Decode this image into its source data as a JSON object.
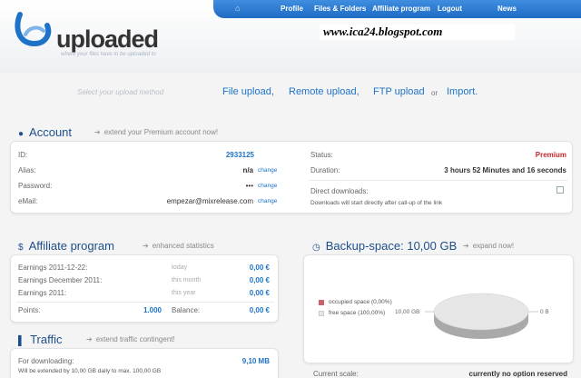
{
  "topnav": {
    "items": [
      "Profile",
      "Files & Folders",
      "Affiliate program",
      "Logout",
      "News"
    ]
  },
  "logo": {
    "text": "uploaded",
    "tagline": "where your files have to be uploaded to"
  },
  "blog_label": "www.ica24.blogspot.com",
  "upload_methods": {
    "hint": "Select your upload method",
    "options": [
      "File upload,",
      "Remote upload,",
      "FTP upload",
      "Import."
    ],
    "or": "or"
  },
  "account": {
    "title": "Account",
    "subtitle": "extend your Premium account now!",
    "id_label": "ID:",
    "id_value": "2933125",
    "alias_label": "Alias:",
    "alias_value": "n/a",
    "password_label": "Password:",
    "password_value": "•••",
    "email_label": "eMail:",
    "email_value": "empezar@mixrelease.com",
    "change": "change",
    "status_label": "Status:",
    "status_value": "Premium",
    "duration_label": "Duration:",
    "duration_value": "3 hours 52 Minutes and 16 seconds",
    "direct_label": "Direct downloads:",
    "direct_note": "Downloads will start directly after call-up of the link"
  },
  "affiliate": {
    "title": "Affiliate program",
    "subtitle": "enhanced statistics",
    "rows": [
      {
        "label": "Earnings 2011-12-22:",
        "period": "today",
        "value": "0,00 €"
      },
      {
        "label": "Earnings December 2011:",
        "period": "this month",
        "value": "0,00 €"
      },
      {
        "label": "Earnings 2011:",
        "period": "this year",
        "value": "0,00 €"
      }
    ],
    "points_label": "Points:",
    "points_value": "1.000",
    "balance_label": "Balance:",
    "balance_value": "0,00 €"
  },
  "traffic": {
    "title": "Traffic",
    "subtitle": "extend traffic contingent!",
    "downloading_label": "For downloading:",
    "downloading_value": "9,10 MB",
    "note": "Will be extended by 10,00 GB daily to max. 100,00 GB"
  },
  "backup": {
    "title": "Backup-space: 10,00 GB",
    "subtitle": "expand now!",
    "legend": [
      {
        "label": "occupied space (0,00%)",
        "color": "#c9636b"
      },
      {
        "label": "free space (100,00%)",
        "color": "#e6e6e6"
      }
    ],
    "left_label": "10,00 GB",
    "right_label": "0 B",
    "scale_label": "Current scale:",
    "scale_value": "currently no option reserved"
  },
  "chart_data": {
    "type": "pie",
    "categories": [
      "occupied space (0,00%)",
      "free space (100,00%)"
    ],
    "values": [
      0.0,
      100.0
    ]
  }
}
